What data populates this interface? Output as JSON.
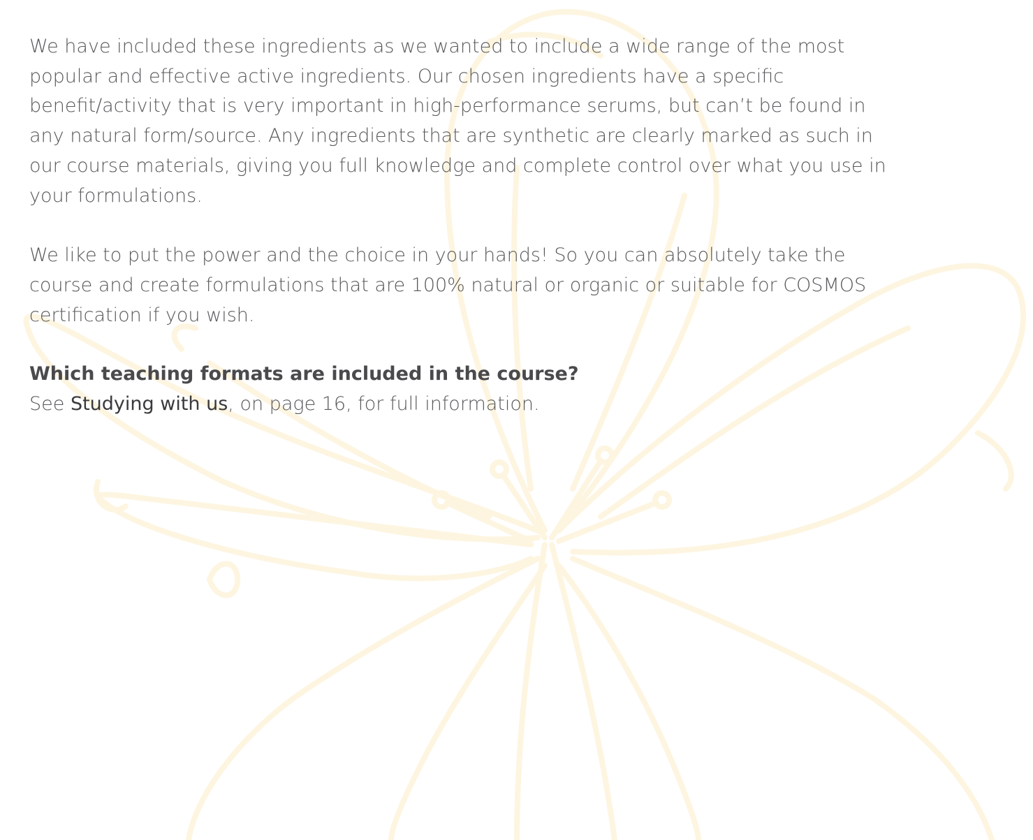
{
  "paragraphs": {
    "p1": "We have included these ingredients as we wanted to include a wide range of the most popular and effective active ingredients. Our chosen ingredients have a specific benefit/activity that is very important in high-performance serums, but can’t be found in any natural form/source. Any ingredients that are synthetic are clearly marked as such in our course materials, giving you full knowledge and complete control over what you use in your formulations.",
    "p2": "We like to put the power and the choice in your hands! So you can absolutely take the course and create formulations that are 100% natural or organic or suitable for COSMOS certification if you wish."
  },
  "faq": {
    "question": "Which teaching formats are included in the course?",
    "answer_prefix": "See ",
    "answer_link": "Studying with us",
    "answer_suffix": ", on page 16, for full information."
  },
  "colors": {
    "text": "#58585b",
    "watermark": "#fdf6e4"
  },
  "icons": {
    "background": "flower-watermark-icon"
  }
}
